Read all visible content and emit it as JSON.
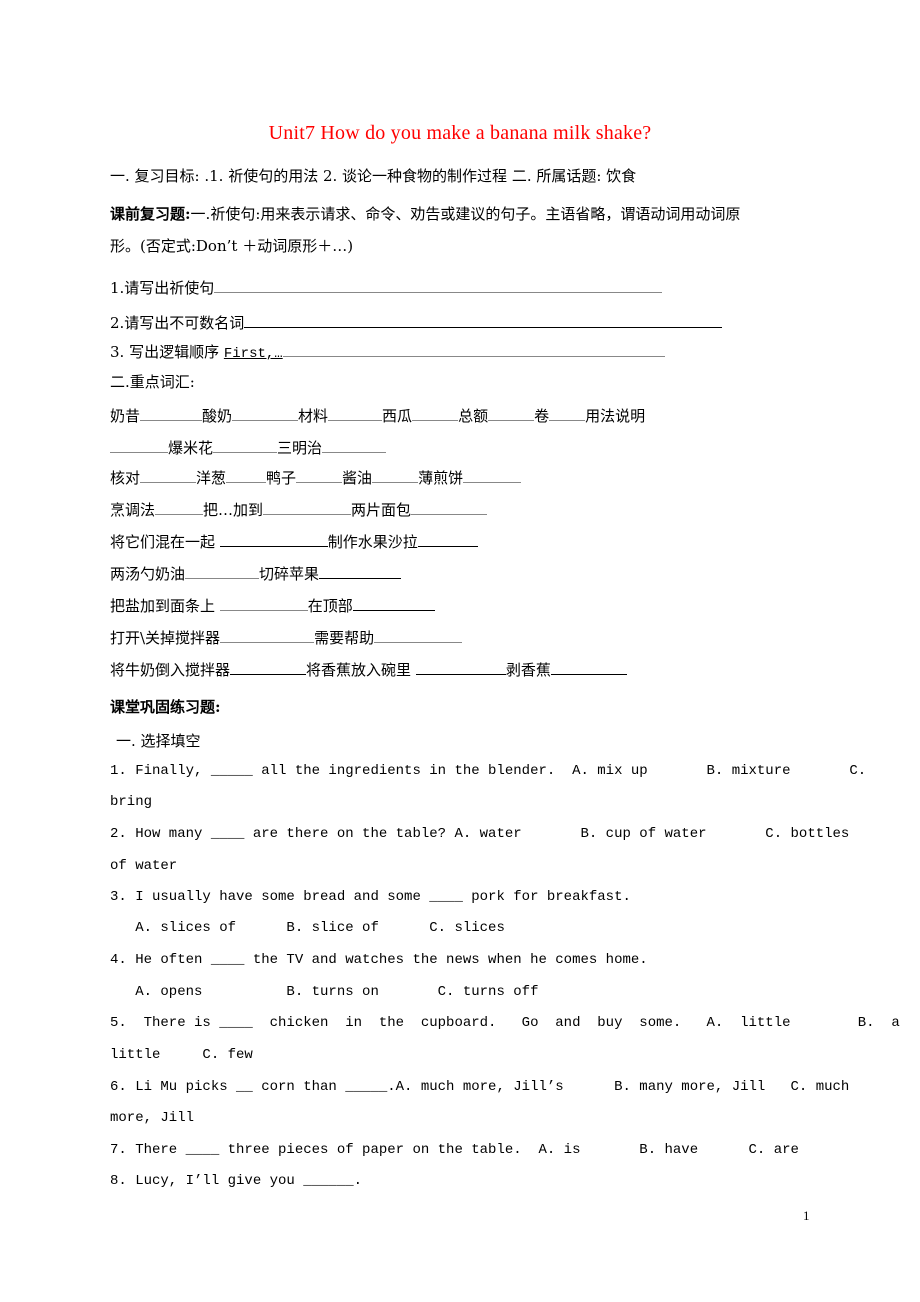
{
  "title": "Unit7  How do you make a banana milk shake?",
  "objectives": "一. 复习目标: .1. 祈使句的用法 2. 谈论一种食物的制作过程  二. 所属话题:  饮食",
  "preview": {
    "label": "课前复习题:",
    "text_line1": "一.祈使句:用来表示请求、命令、劝告或建议的句子。主语省略，谓语动词用动词原",
    "text_line2": "形。(否定式:Don’t ＋动词原形＋…)",
    "q1": "1.请写出祈使句",
    "q2": "2.请写出不可数名词",
    "q3_label": "3.  写出逻辑顺序",
    "q3_hint": "First,…"
  },
  "vocab": {
    "heading": "二.重点词汇:",
    "row1": [
      "奶昔",
      "酸奶",
      "材料",
      "西瓜",
      "总额",
      "卷",
      "用法说明"
    ],
    "row2": [
      "爆米花",
      "三明治"
    ],
    "row3": [
      "核对",
      "洋葱",
      "鸭子",
      "酱油",
      "薄煎饼"
    ],
    "row4": [
      "烹调法",
      "把…加到",
      "两片面包"
    ],
    "row5": [
      "将它们混在一起",
      "制作水果沙拉"
    ],
    "row6": [
      "两汤勺奶油",
      "切碎苹果"
    ],
    "row7": [
      "把盐加到面条上",
      "在顶部"
    ],
    "row8": [
      "打开\\关掉搅拌器",
      "需要帮助"
    ],
    "row9": [
      "将牛奶倒入搅拌器",
      "将香蕉放入碗里",
      "剥香蕉"
    ]
  },
  "practice": {
    "heading": "课堂巩固练习题:",
    "section": "一. 选择填空",
    "lines": [
      "1. Finally, _____ all the ingredients in the blender.  A. mix up       B. mixture       C.",
      "bring",
      "2. How many ____ are there on the table? A. water       B. cup of water       C. bottles",
      "of water",
      "3. I usually have some bread and some ____ pork for breakfast.",
      "   A. slices of      B. slice of      C. slices",
      "4. He often ____ the TV and watches the news when he comes home.",
      "   A. opens          B. turns on       C. turns off",
      "5.  There is ____  chicken  in  the  cupboard.   Go  and  buy  some.   A.  little        B.  a",
      "little     C. few",
      "6. Li Mu picks __ corn than _____.A. much more, Jill’s      B. many more, Jill   C. much",
      "more, Jill",
      "7. There ____ three pieces of paper on the table.  A. is       B. have      C. are",
      "8. Lucy, I’ll give you ______."
    ]
  },
  "page_number": "1"
}
